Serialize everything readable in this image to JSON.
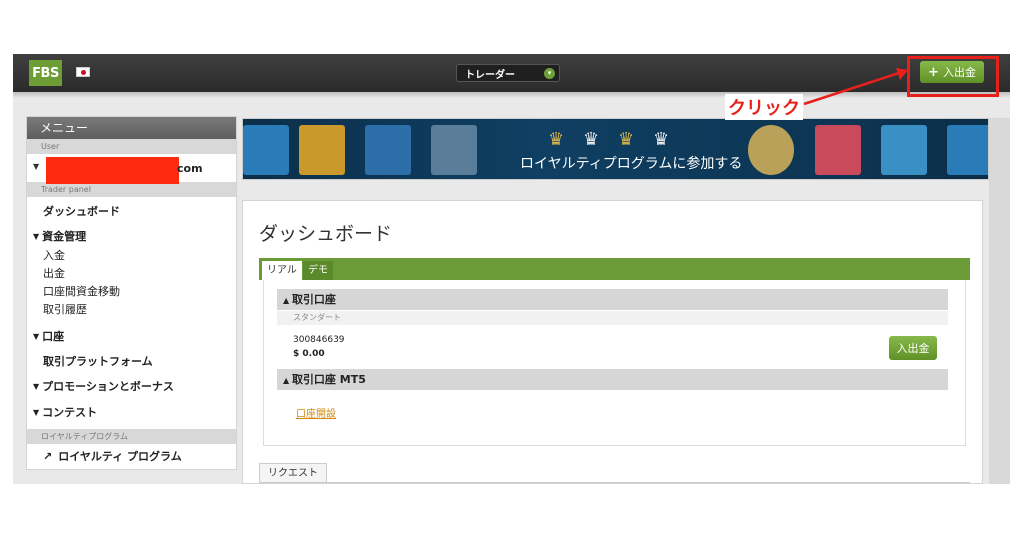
{
  "topbar": {
    "logo": "FBS",
    "mode_select": "トレーダー",
    "deposit_button": "入出金",
    "deposit_plus": "+"
  },
  "annotation": {
    "label": "クリック",
    "color": "#e8201b"
  },
  "sidebar": {
    "menu_header": "メニュー",
    "user_section": "User",
    "user_email_suffix": "com",
    "trader_panel_section": "Trader panel",
    "dashboard": "ダッシュボード",
    "funds_group": "資金管理",
    "funds_items": [
      "入金",
      "出金",
      "口座間資金移動",
      "取引履歴"
    ],
    "accounts_group": "口座",
    "trading_platform": "取引プラットフォーム",
    "promotions_group": "プロモーションとボーナス",
    "contest_group": "コンテスト",
    "loyalty_section": "ロイヤルティプログラム",
    "loyalty_link": "ロイヤルティ プログラム"
  },
  "banner": {
    "text": "ロイヤルティプログラムに参加する"
  },
  "main": {
    "title": "ダッシュボード",
    "tabs": [
      "リアル",
      "デモ"
    ],
    "accounts_header": "取引口座",
    "account_type": "スタンダート",
    "account_number": "300846639",
    "balance": "$ 0.00",
    "deposit_button": "入出金",
    "mt5_header": "取引口座 MT5",
    "open_account_link": "口座開設",
    "request_tab": "リクエスト"
  },
  "colors": {
    "accent_green": "#6a9b37",
    "topbar": "#333333",
    "link_orange": "#d08a10"
  },
  "icons": [
    "fbs-logo-icon",
    "japan-flag-icon",
    "plus-icon",
    "external-link-icon",
    "caret-down-icon",
    "caret-up-icon"
  ]
}
